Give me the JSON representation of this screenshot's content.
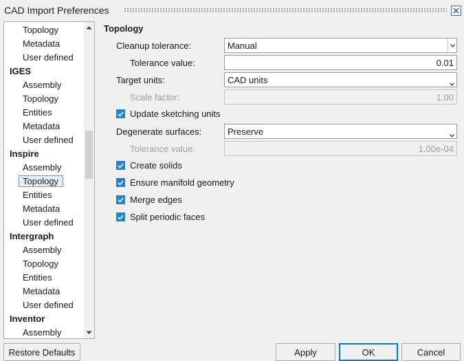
{
  "window": {
    "title": "CAD Import Preferences"
  },
  "tree": {
    "items": [
      {
        "label": "Topology",
        "kind": "child"
      },
      {
        "label": "Metadata",
        "kind": "child"
      },
      {
        "label": "User defined",
        "kind": "child"
      },
      {
        "label": "IGES",
        "kind": "group"
      },
      {
        "label": "Assembly",
        "kind": "child"
      },
      {
        "label": "Topology",
        "kind": "child"
      },
      {
        "label": "Entities",
        "kind": "child"
      },
      {
        "label": "Metadata",
        "kind": "child"
      },
      {
        "label": "User defined",
        "kind": "child"
      },
      {
        "label": "Inspire",
        "kind": "group"
      },
      {
        "label": "Assembly",
        "kind": "child"
      },
      {
        "label": "Topology",
        "kind": "child",
        "selected": true
      },
      {
        "label": "Entities",
        "kind": "child"
      },
      {
        "label": "Metadata",
        "kind": "child"
      },
      {
        "label": "User defined",
        "kind": "child"
      },
      {
        "label": "Intergraph",
        "kind": "group"
      },
      {
        "label": "Assembly",
        "kind": "child"
      },
      {
        "label": "Topology",
        "kind": "child"
      },
      {
        "label": "Entities",
        "kind": "child"
      },
      {
        "label": "Metadata",
        "kind": "child"
      },
      {
        "label": "User defined",
        "kind": "child"
      },
      {
        "label": "Inventor",
        "kind": "group"
      },
      {
        "label": "Assembly",
        "kind": "child"
      }
    ]
  },
  "panel": {
    "title": "Topology",
    "cleanup_tolerance": {
      "label": "Cleanup tolerance:",
      "value": "Manual"
    },
    "tolerance_value": {
      "label": "Tolerance value:",
      "value": "0.01"
    },
    "target_units": {
      "label": "Target units:",
      "value": "CAD units"
    },
    "scale_factor": {
      "label": "Scale factor:",
      "value": "1.00"
    },
    "update_sketching_units": {
      "label": "Update sketching units",
      "checked": true
    },
    "degenerate_surfaces": {
      "label": "Degenerate surfaces:",
      "value": "Preserve"
    },
    "degenerate_tolerance": {
      "label": "Tolerance value:",
      "value": "1.00e-04"
    },
    "create_solids": {
      "label": "Create solids",
      "checked": true
    },
    "ensure_manifold": {
      "label": "Ensure manifold geometry",
      "checked": true
    },
    "merge_edges": {
      "label": "Merge edges",
      "checked": true
    },
    "split_periodic": {
      "label": "Split periodic faces",
      "checked": true
    }
  },
  "buttons": {
    "restore_defaults": "Restore Defaults",
    "apply": "Apply",
    "ok": "OK",
    "cancel": "Cancel"
  },
  "colors": {
    "checkbox": "#1f84d4",
    "default_button_border": "#0078d7"
  }
}
